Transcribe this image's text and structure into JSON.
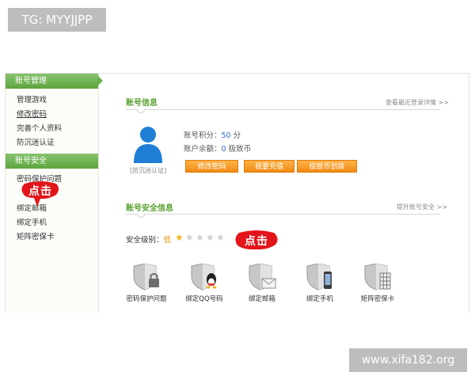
{
  "watermarks": {
    "top_left": "TG: MYYJJPP",
    "bottom_right": "www.xifa182.org"
  },
  "sidebar": {
    "section1_title": "账号管理",
    "section1_items": [
      {
        "label": "管理游戏"
      },
      {
        "label": "修改密码"
      },
      {
        "label": "完善个人资料"
      },
      {
        "label": "防沉迷认证"
      }
    ],
    "section2_title": "账号安全",
    "section2_items": [
      {
        "label": "密码保护问题"
      },
      {
        "label": "绑定邮箱"
      },
      {
        "label": "绑定手机"
      },
      {
        "label": "矩阵密保卡"
      }
    ]
  },
  "callouts": {
    "left": "点击",
    "right": "点击"
  },
  "account_info": {
    "title": "账号信息",
    "more_link": "查看最近登录详情 >>",
    "avatar_caption": "[防沉迷认证]",
    "points_label": "账号积分：",
    "points_value": "50",
    "points_unit": "分",
    "balance_label": "账户余额：",
    "balance_value": "0",
    "balance_unit": "极致币",
    "buttons": {
      "change_password": "修改密码",
      "recharge": "我要充值",
      "transfer": "极致币划拨"
    }
  },
  "security_info": {
    "title": "账号安全信息",
    "more_link": "提升账号安全 >>",
    "level_label": "安全级别：",
    "level_value": "低",
    "stars_filled": 1,
    "stars_total": 5,
    "items": [
      {
        "label": "密码保护问题",
        "icon": "shield-lock-icon"
      },
      {
        "label": "绑定QQ号码",
        "icon": "shield-qq-icon"
      },
      {
        "label": "绑定邮箱",
        "icon": "shield-mail-icon"
      },
      {
        "label": "绑定手机",
        "icon": "shield-phone-icon"
      },
      {
        "label": "矩阵密保卡",
        "icon": "shield-card-icon"
      }
    ]
  },
  "colors": {
    "accent_green": "#5aa230",
    "button_orange": "#f08a12",
    "callout_red": "#e3141a",
    "link_blue": "#2e6ec7"
  }
}
